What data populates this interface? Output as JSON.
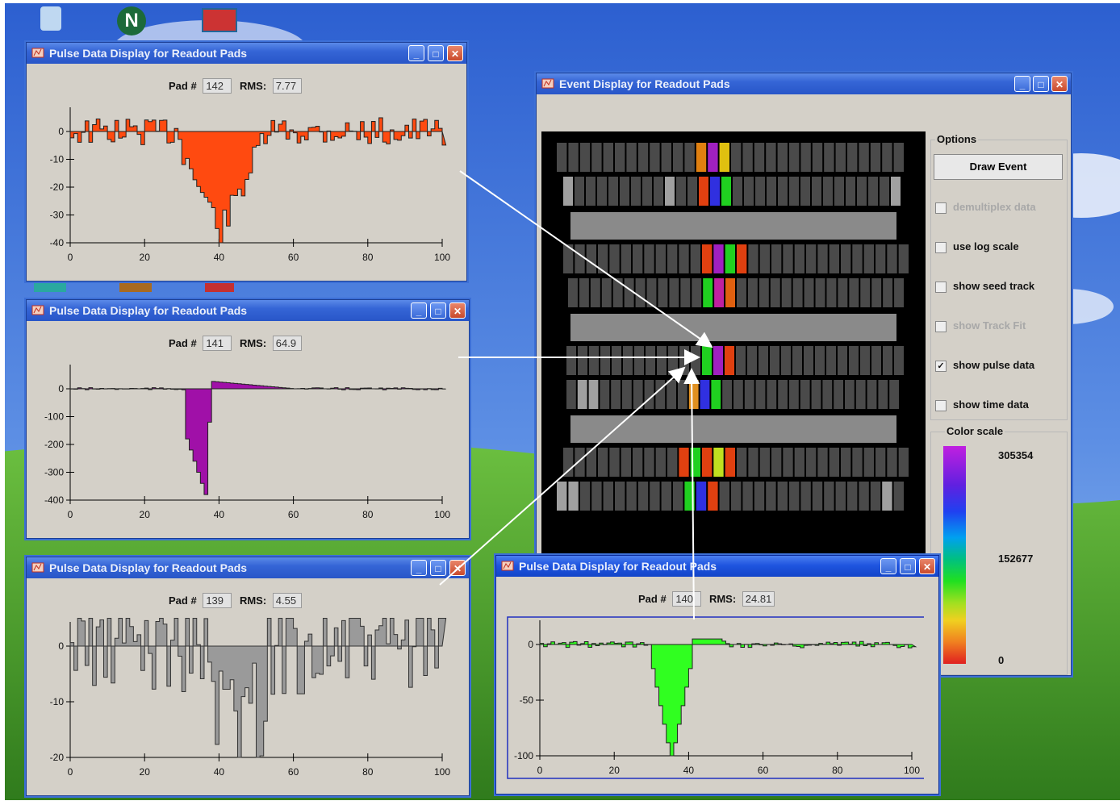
{
  "windows": {
    "pulse_title": "Pulse Data Display for Readout Pads",
    "event_title": "Event Display for Readout Pads"
  },
  "pad_label": "Pad #",
  "rms_label": "RMS:",
  "pulse_windows": [
    {
      "pad": "142",
      "rms": "7.77",
      "color": "#ff4a10",
      "ylim": [
        -40,
        0
      ],
      "yticks": [
        "0",
        "-10",
        "-20",
        "-30",
        "-40"
      ],
      "xticks": [
        "0",
        "20",
        "40",
        "60",
        "80",
        "100"
      ]
    },
    {
      "pad": "141",
      "rms": "64.9",
      "color": "#a010a8",
      "ylim": [
        -400,
        0
      ],
      "yticks": [
        "0",
        "-100",
        "-200",
        "-300",
        "-400"
      ],
      "xticks": [
        "0",
        "20",
        "40",
        "60",
        "80",
        "100"
      ]
    },
    {
      "pad": "139",
      "rms": "4.55",
      "color": "#9a9a9a",
      "ylim": [
        -20,
        0
      ],
      "yticks": [
        "0",
        "-10",
        "-20"
      ],
      "xticks": [
        "0",
        "20",
        "40",
        "60",
        "80",
        "100"
      ]
    },
    {
      "pad": "140",
      "rms": "24.81",
      "color": "#30ff20",
      "ylim": [
        -100,
        0
      ],
      "yticks": [
        "0",
        "-50",
        "-100"
      ],
      "xticks": [
        "0",
        "20",
        "40",
        "60",
        "80",
        "100"
      ]
    }
  ],
  "event": {
    "options_label": "Options",
    "draw_button": "Draw Event",
    "options": [
      {
        "label": "demultiplex data",
        "checked": false,
        "enabled": false
      },
      {
        "label": "use log scale",
        "checked": false,
        "enabled": true
      },
      {
        "label": "show seed track",
        "checked": false,
        "enabled": true
      },
      {
        "label": "show Track Fit",
        "checked": false,
        "enabled": false
      },
      {
        "label": "show pulse data",
        "checked": true,
        "enabled": true
      },
      {
        "label": "show time data",
        "checked": false,
        "enabled": true
      }
    ],
    "color_scale_label": "Color scale",
    "scale_values": [
      "305354",
      "152677",
      "0"
    ]
  },
  "colors": {
    "desktop_sky": "#3a6fd8",
    "desktop_grass": "#4aa030",
    "panel": "#d4d0c8"
  }
}
